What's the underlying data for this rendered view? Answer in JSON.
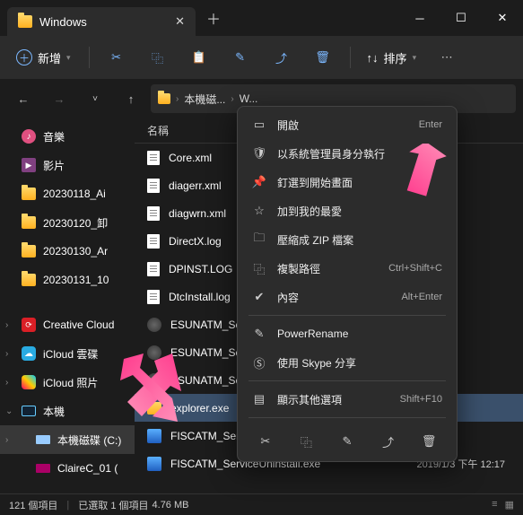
{
  "titlebar": {
    "tab_title": "Windows"
  },
  "toolbar": {
    "new_label": "新增",
    "sort_label": "排序"
  },
  "breadcrumb": {
    "seg1": "本機磁...",
    "seg2": "W..."
  },
  "sidebar": {
    "items": [
      {
        "label": "音樂",
        "type": "music"
      },
      {
        "label": "影片",
        "type": "video"
      },
      {
        "label": "20230118_Ai",
        "type": "folder"
      },
      {
        "label": "20230120_卸",
        "type": "folder"
      },
      {
        "label": "20230130_Ar",
        "type": "folder"
      },
      {
        "label": "20230131_10",
        "type": "folder"
      }
    ],
    "groups": [
      {
        "label": "Creative Cloud",
        "type": "cc",
        "exp": ">"
      },
      {
        "label": "iCloud 雲碟",
        "type": "cloud",
        "exp": ">"
      },
      {
        "label": "iCloud 照片",
        "type": "photo",
        "exp": ">"
      },
      {
        "label": "本機",
        "type": "pc",
        "exp": "v"
      },
      {
        "label": "本機磁碟 (C:)",
        "type": "disk",
        "exp": ">",
        "sel": true,
        "indent": true
      },
      {
        "label": "ClaireC_01 (",
        "type": "disk",
        "exp": "",
        "indent": true,
        "purple": true
      }
    ]
  },
  "columns": {
    "name": "名稱"
  },
  "files": [
    {
      "name": "Core.xml",
      "icon": "doc"
    },
    {
      "name": "diagerr.xml",
      "icon": "doc"
    },
    {
      "name": "diagwrn.xml",
      "icon": "doc"
    },
    {
      "name": "DirectX.log",
      "icon": "doc"
    },
    {
      "name": "DPINST.LOG",
      "icon": "doc"
    },
    {
      "name": "DtcInstall.log",
      "icon": "doc"
    },
    {
      "name": "ESUNATM_Se",
      "icon": "gear"
    },
    {
      "name": "ESUNATM_Se",
      "icon": "gear"
    },
    {
      "name": "ESUNATM_Se",
      "icon": "gear"
    },
    {
      "name": "explorer.exe",
      "icon": "folder",
      "sel": true
    },
    {
      "name": "FISCATM_Serv",
      "icon": "app"
    },
    {
      "name": "FISCATM_ServiceUninstall.exe",
      "icon": "app",
      "date": "2019/1/3 下午 12:17"
    }
  ],
  "context_menu": {
    "items": [
      {
        "label": "開啟",
        "shortcut": "Enter",
        "icon": "open"
      },
      {
        "label": "以系統管理員身分執行",
        "icon": "admin"
      },
      {
        "label": "釘選到開始畫面",
        "icon": "pin"
      },
      {
        "label": "加到我的最愛",
        "icon": "star"
      },
      {
        "label": "壓縮成 ZIP 檔案",
        "icon": "zip"
      },
      {
        "label": "複製路徑",
        "shortcut": "Ctrl+Shift+C",
        "icon": "copy"
      },
      {
        "label": "內容",
        "shortcut": "Alt+Enter",
        "icon": "props"
      }
    ],
    "items2": [
      {
        "label": "PowerRename",
        "icon": "rename"
      },
      {
        "label": "使用 Skype 分享",
        "icon": "skype"
      }
    ],
    "items3": [
      {
        "label": "顯示其他選項",
        "shortcut": "Shift+F10",
        "icon": "more"
      }
    ]
  },
  "status": {
    "count": "121 個項目",
    "selection": "已選取 1 個項目",
    "size": "4.76 MB"
  }
}
